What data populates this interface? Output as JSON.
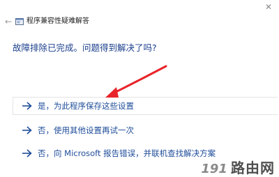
{
  "window": {
    "title": "程序兼容性疑难解答"
  },
  "heading": "故障排除已完成。问题得到解决了吗?",
  "options": [
    {
      "label": "是，为此程序保存这些设置"
    },
    {
      "label": "否，使用其他设置再试一次"
    },
    {
      "label": "否，向 Microsoft 报告错误，并联机查找解决方案"
    }
  ],
  "watermark": {
    "number": "191",
    "text": "路由网"
  },
  "colors": {
    "accent": "#1f4d9a",
    "heading": "#1a3e8c",
    "annotation_arrow": "#e8242a"
  },
  "icons": {
    "back": "back-arrow-icon",
    "close": "close-icon",
    "app": "compatibility-troubleshooter-icon",
    "option": "arrow-right-icon"
  }
}
